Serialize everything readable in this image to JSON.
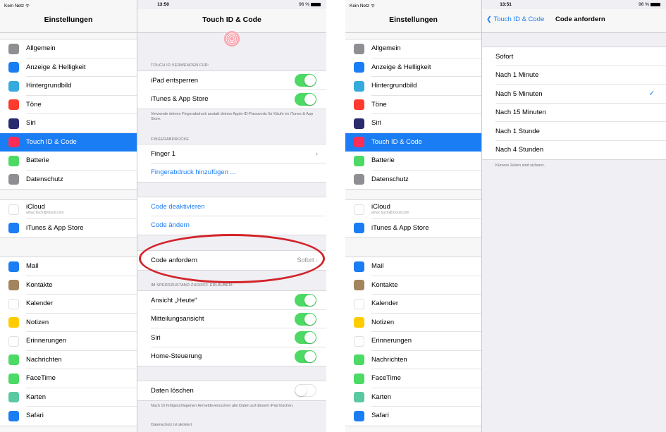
{
  "left_screen": {
    "status": {
      "carrier": "Kein Netz ᯤ",
      "time": "13:50",
      "battery": "96 %"
    },
    "sidebar": {
      "title": "Einstellungen",
      "groups": [
        [
          {
            "label": "Allgemein",
            "icon": "gear-icon",
            "color": "#8e8e93"
          },
          {
            "label": "Anzeige & Helligkeit",
            "icon": "brightness-icon",
            "color": "#1b7df3"
          },
          {
            "label": "Hintergrundbild",
            "icon": "wallpaper-icon",
            "color": "#35aadc"
          },
          {
            "label": "Töne",
            "icon": "sound-icon",
            "color": "#ff3b30"
          },
          {
            "label": "Siri",
            "icon": "siri-icon",
            "color": "#2a2a6e"
          },
          {
            "label": "Touch ID & Code",
            "icon": "fingerprint-icon",
            "color": "#ff2d55"
          },
          {
            "label": "Batterie",
            "icon": "battery-icon",
            "color": "#4cd964"
          },
          {
            "label": "Datenschutz",
            "icon": "hand-icon",
            "color": "#8e8e93"
          }
        ],
        [
          {
            "label": "iCloud",
            "sub": "amac.buch@icloud.com",
            "icon": "cloud-icon",
            "color": "#ffffff"
          },
          {
            "label": "iTunes & App Store",
            "icon": "appstore-icon",
            "color": "#1b7df3"
          }
        ],
        [
          {
            "label": "Mail",
            "icon": "mail-icon",
            "color": "#1b7df3"
          },
          {
            "label": "Kontakte",
            "icon": "contacts-icon",
            "color": "#a2845e"
          },
          {
            "label": "Kalender",
            "icon": "calendar-icon",
            "color": "#ffffff"
          },
          {
            "label": "Notizen",
            "icon": "notes-icon",
            "color": "#ffcc00"
          },
          {
            "label": "Erinnerungen",
            "icon": "reminders-icon",
            "color": "#ffffff"
          },
          {
            "label": "Nachrichten",
            "icon": "messages-icon",
            "color": "#4cd964"
          },
          {
            "label": "FaceTime",
            "icon": "facetime-icon",
            "color": "#4cd964"
          },
          {
            "label": "Karten",
            "icon": "maps-icon",
            "color": "#5ac8a0"
          },
          {
            "label": "Safari",
            "icon": "safari-icon",
            "color": "#1b7df3"
          }
        ]
      ]
    },
    "detail": {
      "title": "Touch ID & Code",
      "touchid_header": "TOUCH ID VERWENDEN FÜR:",
      "unlock_label": "iPad entsperren",
      "store_label": "iTunes & App Store",
      "touchid_footer": "Verwende deinen Fingerabdruck anstatt deines Apple-ID-Passworts für Käufe im iTunes & App Store.",
      "fingerprints_header": "FINGERABDRÜCKE",
      "finger1_label": "Finger 1",
      "add_fingerprint_label": "Fingerabdruck hinzufügen ...",
      "code_off_label": "Code deaktivieren",
      "code_change_label": "Code ändern",
      "require_code_label": "Code anfordern",
      "require_code_value": "Sofort",
      "locked_header": "IM SPERRZUSTAND ZUGRIFF ERLAUBEN:",
      "today_label": "Ansicht „Heute“",
      "notifications_label": "Mitteilungsansicht",
      "siri_label": "Siri",
      "home_label": "Home-Steuerung",
      "erase_label": "Daten löschen",
      "erase_footer": "Nach 10 fehlgeschlagenen Anmeldeversuchen alle Daten auf diesem iPad löschen.",
      "privacy_footer": "Datenschutz ist aktiviert."
    }
  },
  "right_screen": {
    "status": {
      "carrier": "Kein Netz ᯤ",
      "time": "13:51",
      "battery": "96 %"
    },
    "back_label": "Touch ID & Code",
    "title": "Code anfordern",
    "options": [
      {
        "label": "Sofort",
        "checked": false
      },
      {
        "label": "Nach 1 Minute",
        "checked": false
      },
      {
        "label": "Nach 5 Minuten",
        "checked": true
      },
      {
        "label": "Nach 15 Minuten",
        "checked": false
      },
      {
        "label": "Nach 1 Stunde",
        "checked": false
      },
      {
        "label": "Nach 4 Stunden",
        "checked": false
      }
    ],
    "footer": "Kürzere Zeiten sind sicherer.",
    "check_glyph": "✓",
    "back_glyph": "❮",
    "chevron_glyph": "›"
  }
}
